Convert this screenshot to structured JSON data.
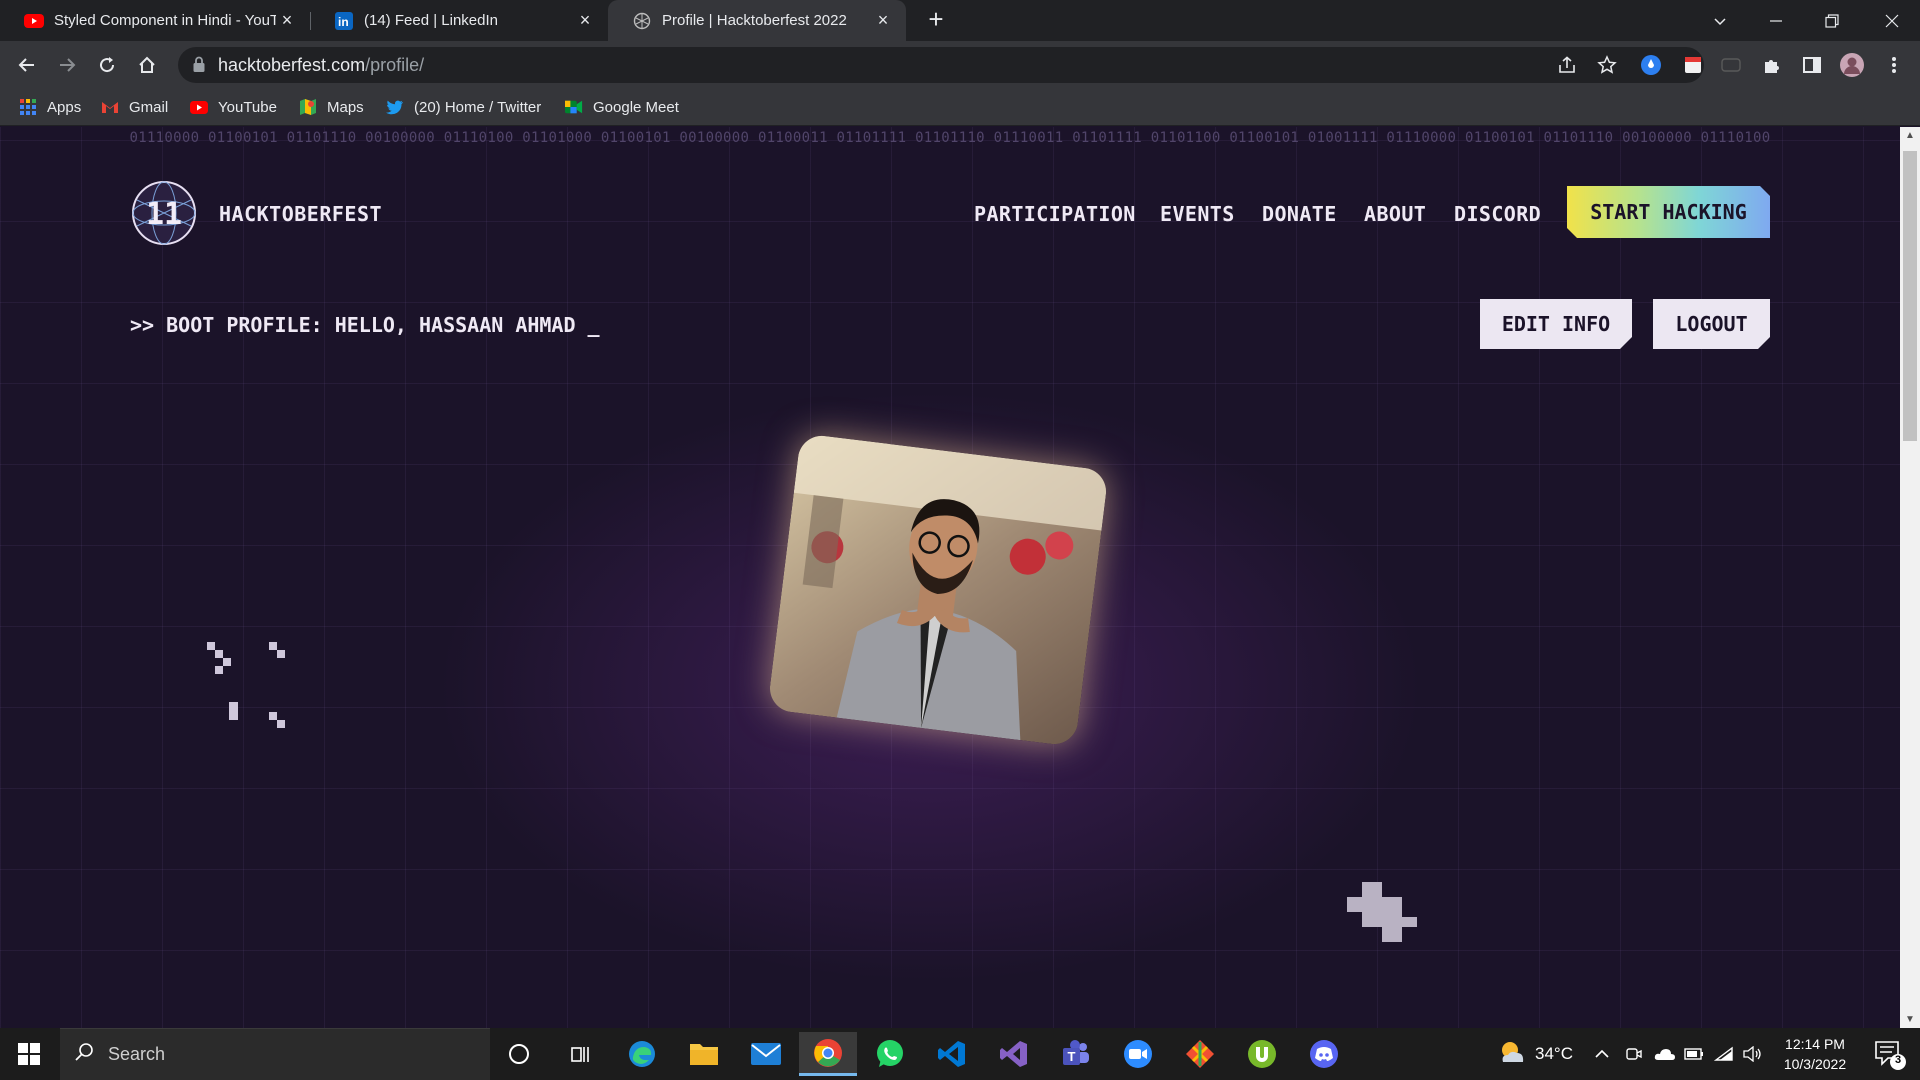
{
  "tabs": [
    {
      "title": "Styled Component in Hindi - YouTube",
      "icon": "youtube-icon"
    },
    {
      "title": "(14) Feed | LinkedIn",
      "icon": "linkedin-icon"
    },
    {
      "title": "Profile | Hacktoberfest 2022",
      "icon": "hacktoberfest-icon",
      "active": true
    }
  ],
  "address_bar": {
    "domain": "hacktoberfest.com",
    "path": "/profile/"
  },
  "bookmarks": [
    {
      "label": "Apps",
      "icon": "apps-grid-icon"
    },
    {
      "label": "Gmail",
      "icon": "gmail-icon"
    },
    {
      "label": "YouTube",
      "icon": "youtube-icon"
    },
    {
      "label": "Maps",
      "icon": "maps-icon"
    },
    {
      "label": "(20) Home / Twitter",
      "icon": "twitter-icon"
    },
    {
      "label": "Google Meet",
      "icon": "google-meet-icon"
    }
  ],
  "page": {
    "binary_strip": "01110000 01100101 01101110 00100000 01110100 01101000 01100101 00100000 01100011 01101111 01101110 01110011 01101111 01101100 01100101 01001111 01110000 01100101 01101110 00100000 01110100",
    "brand": "HACKTOBERFEST",
    "nav": [
      "PARTICIPATION",
      "EVENTS",
      "DONATE",
      "ABOUT",
      "DISCORD"
    ],
    "cta": "START HACKING",
    "boot_line": ">> BOOT PROFILE: HELLO, HASSAAN AHMAD _",
    "edit_info": "EDIT INFO",
    "logout": "LOGOUT",
    "colors": {
      "background": "#1b1329",
      "text": "#efe9f5",
      "button_light": "#ece7f2"
    }
  },
  "taskbar": {
    "search_label": "Search",
    "weather": "34°C",
    "time": "12:14 PM",
    "date": "10/3/2022",
    "notification_count": "3",
    "apps": [
      "cortana-icon",
      "task-view-icon",
      "edge-icon",
      "file-explorer-icon",
      "mail-icon",
      "chrome-icon",
      "whatsapp-icon",
      "vscode-icon",
      "visual-studio-icon",
      "teams-icon",
      "zoom-icon",
      "git-icon",
      "utorrent-icon",
      "discord-icon"
    ]
  }
}
